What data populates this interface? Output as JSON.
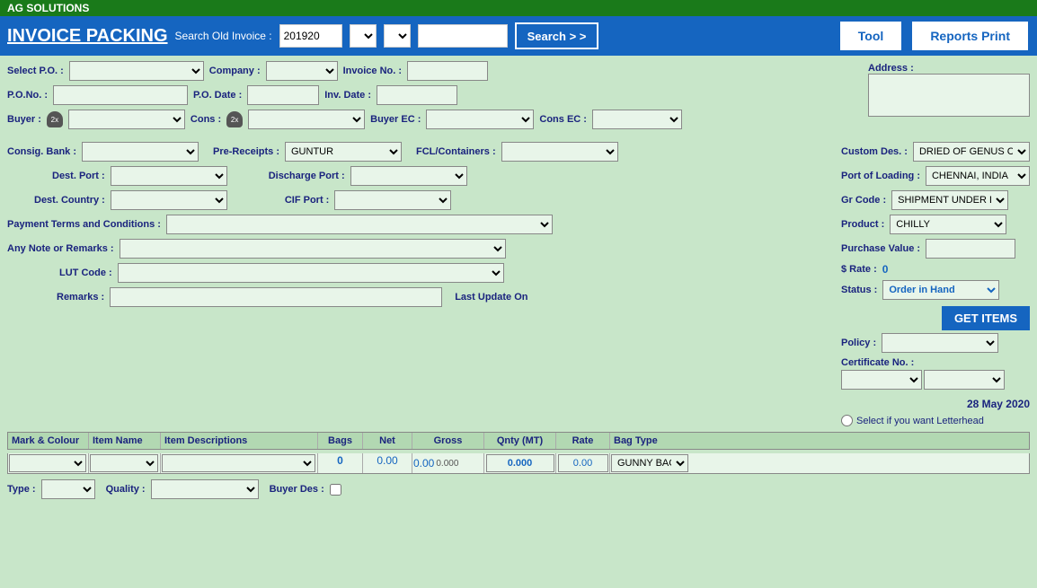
{
  "app": {
    "company": "AG SOLUTIONS",
    "title": "INVOICE PACKING"
  },
  "header": {
    "search_old_invoice_label": "Search Old Invoice :",
    "search_old_invoice_value": "201920",
    "search_btn": "Search > >",
    "tool_btn": "Tool",
    "reports_btn": "Reports Print"
  },
  "form": {
    "select_po_label": "Select P.O. :",
    "po_no_label": "P.O.No. :",
    "buyer_label": "Buyer :",
    "company_label": "Company :",
    "po_date_label": "P.O. Date :",
    "cons_label": "Cons :",
    "invoice_no_label": "Invoice No. :",
    "inv_date_label": "Inv. Date :",
    "buyer_ec_label": "Buyer EC :",
    "cons_ec_label": "Cons EC :",
    "address_label": "Address :",
    "consig_bank_label": "Consig. Bank :",
    "pre_receipts_label": "Pre-Receipts :",
    "pre_receipts_value": "GUNTUR",
    "fcl_containers_label": "FCL/Containers :",
    "dest_port_label": "Dest. Port :",
    "discharge_port_label": "Discharge Port :",
    "dest_country_label": "Dest. Country :",
    "cif_port_label": "CIF Port :",
    "payment_terms_label": "Payment Terms and Conditions :",
    "any_note_label": "Any Note or Remarks :",
    "lut_code_label": "LUT Code :",
    "remarks_label": "Remarks :",
    "last_update_label": "Last Update On"
  },
  "right_panel": {
    "custom_des_label": "Custom Des. :",
    "custom_des_value": "DRIED OF GENUS CAPSICUM",
    "port_loading_label": "Port of Loading :",
    "port_loading_value": "CHENNAI, INDIA",
    "gr_code_label": "Gr Code :",
    "gr_code_value": "SHIPMENT UNDER DUTY DRAW",
    "product_label": "Product :",
    "product_value": "CHILLY",
    "purchase_value_label": "Purchase Value :",
    "s_rate_label": "$ Rate :",
    "s_rate_value": "0",
    "status_label": "Status :",
    "status_value": "Order in Hand",
    "get_items_btn": "GET ITEMS",
    "policy_label": "Policy :",
    "certificate_no_label": "Certificate No. :"
  },
  "table": {
    "headers": [
      "Mark & Colour",
      "Item Name",
      "Item Descriptions",
      "Bags",
      "Net",
      "Gross",
      "",
      "Qnty (MT)",
      "Rate",
      "Bag Type"
    ],
    "row": {
      "bags": "0",
      "net": "0.00",
      "gross": "0.00",
      "gross2": "0.000",
      "qnty": "0.000",
      "rate": "0.00",
      "bag_type": "GUNNY BAGS"
    }
  },
  "bottom": {
    "type_label": "Type :",
    "quality_label": "Quality :",
    "buyer_des_label": "Buyer Des :",
    "date": "28 May 2020",
    "letterhead_label": "Select if you want Letterhead"
  }
}
